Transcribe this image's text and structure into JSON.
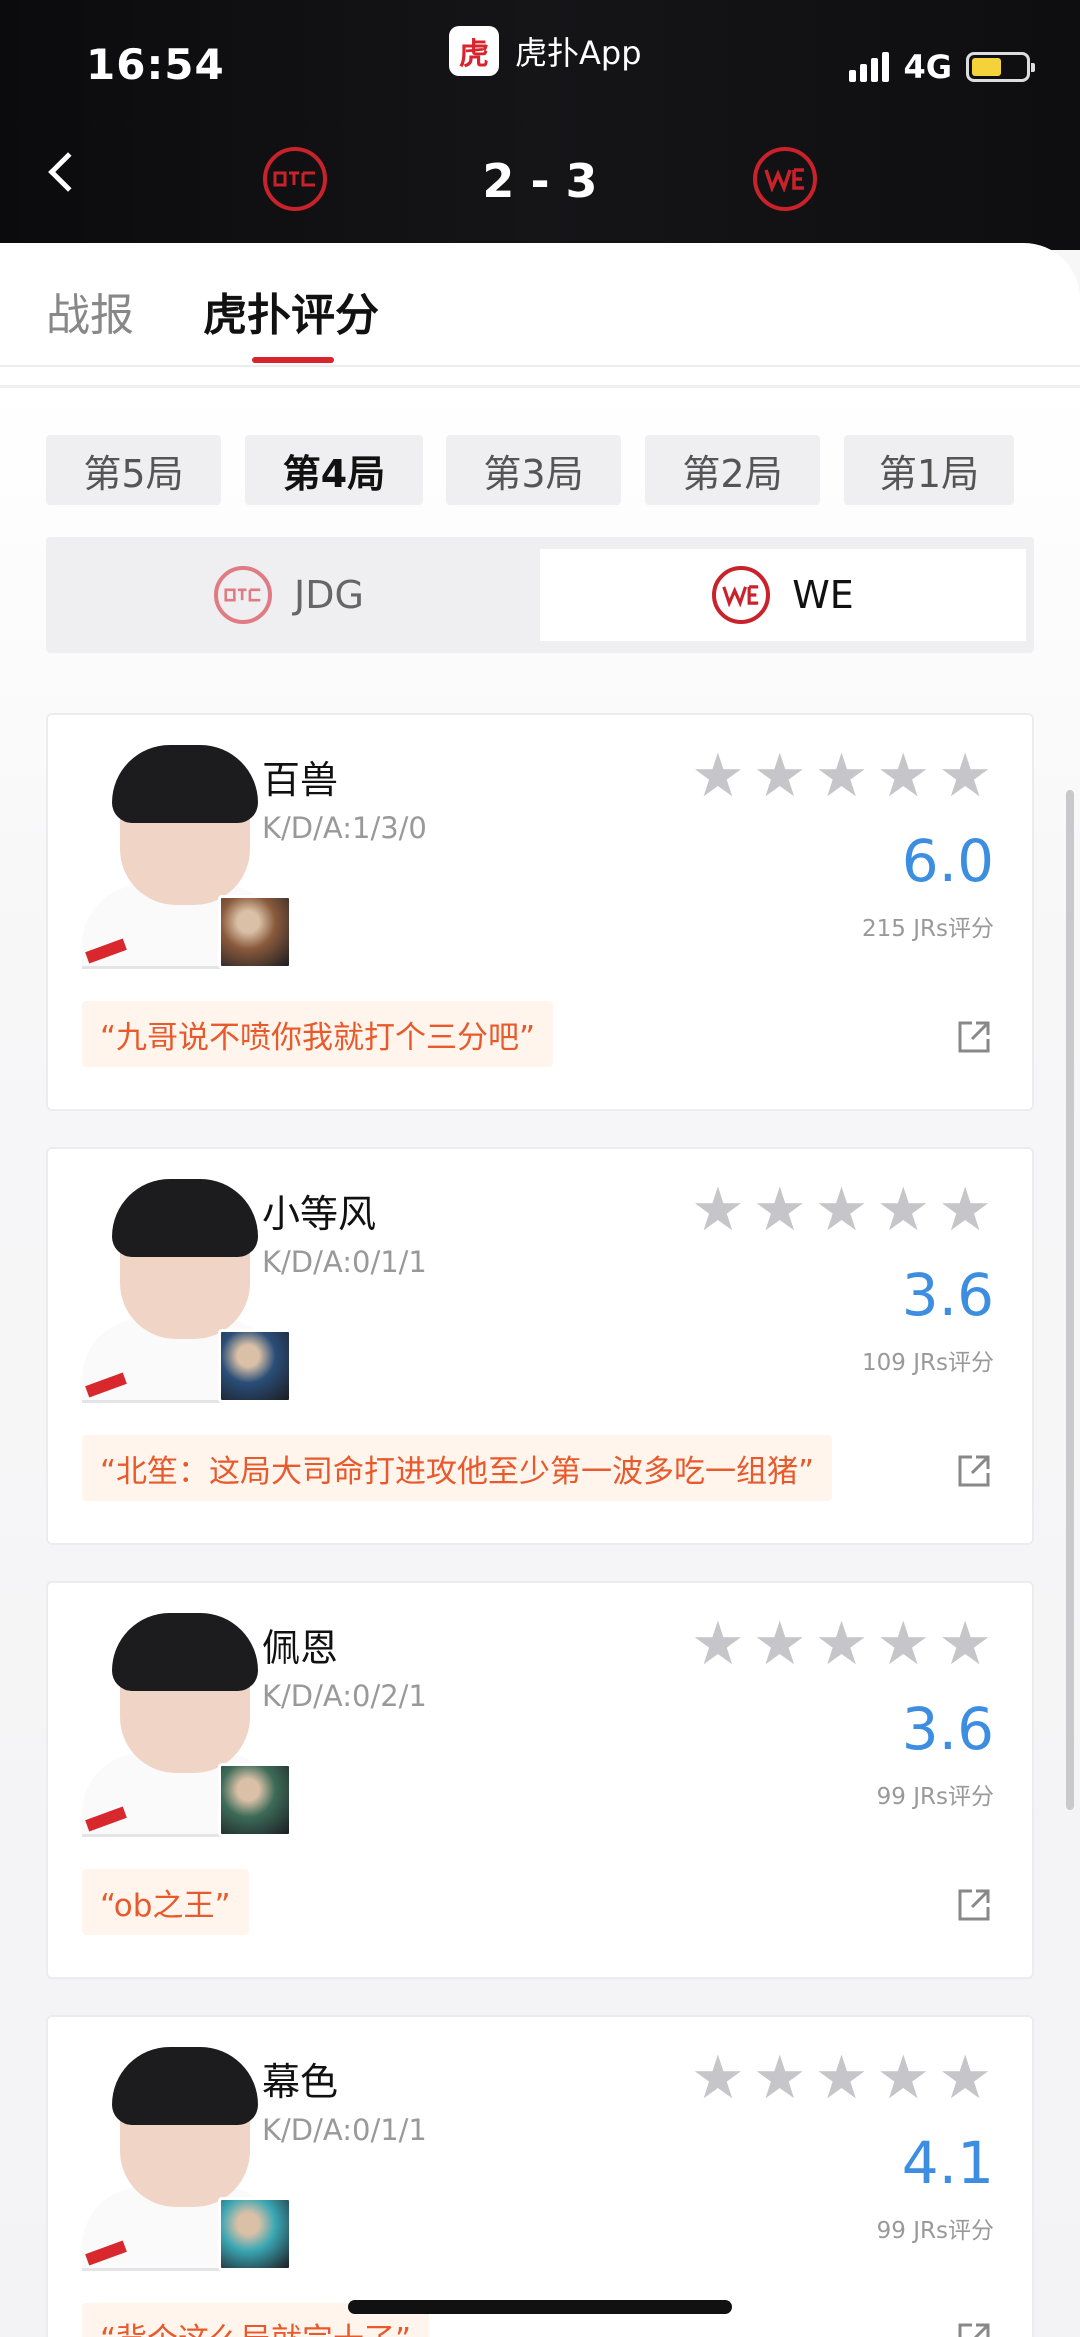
{
  "status_bar": {
    "time": "16:54",
    "app_name": "虎扑App",
    "app_logo_char": "虎",
    "network": "4G"
  },
  "match": {
    "score": "2 - 3",
    "team_left_short": "JDG",
    "team_right_short": "WE"
  },
  "tabs": [
    {
      "label": "战报"
    },
    {
      "label": "虎扑评分"
    }
  ],
  "games": [
    "第5局",
    "第4局",
    "第3局",
    "第2局",
    "第1局"
  ],
  "active_game": "第4局",
  "teams": [
    "JDG",
    "WE"
  ],
  "selected_team": "WE",
  "players": [
    {
      "name": "百兽",
      "kda": "K/D/A:1/3/0",
      "rating": "6.0",
      "votes": "215 JRs评分",
      "quote": "“九哥说不喷你我就打个三分吧”",
      "stars": 5,
      "hero_color": "#8a5a3c"
    },
    {
      "name": "小等风",
      "kda": "K/D/A:0/1/1",
      "rating": "3.6",
      "votes": "109 JRs评分",
      "quote": "“北笙：这局大司命打进攻他至少第一波多吃一组猪”",
      "stars": 5,
      "hero_color": "#2a4e78"
    },
    {
      "name": "佩恩",
      "kda": "K/D/A:0/2/1",
      "rating": "3.6",
      "votes": "99 JRs评分",
      "quote": "“ob之王”",
      "stars": 5,
      "hero_color": "#3d6b58"
    },
    {
      "name": "幕色",
      "kda": "K/D/A:0/1/1",
      "rating": "4.1",
      "votes": "99 JRs评分",
      "quote": "“背个这么局就完十了”",
      "stars": 5,
      "hero_color": "#3aa7b4"
    }
  ],
  "colors": {
    "accent_red": "#d9232d",
    "rating_blue": "#3d8ee0",
    "quote_orange": "#e85a2c"
  }
}
